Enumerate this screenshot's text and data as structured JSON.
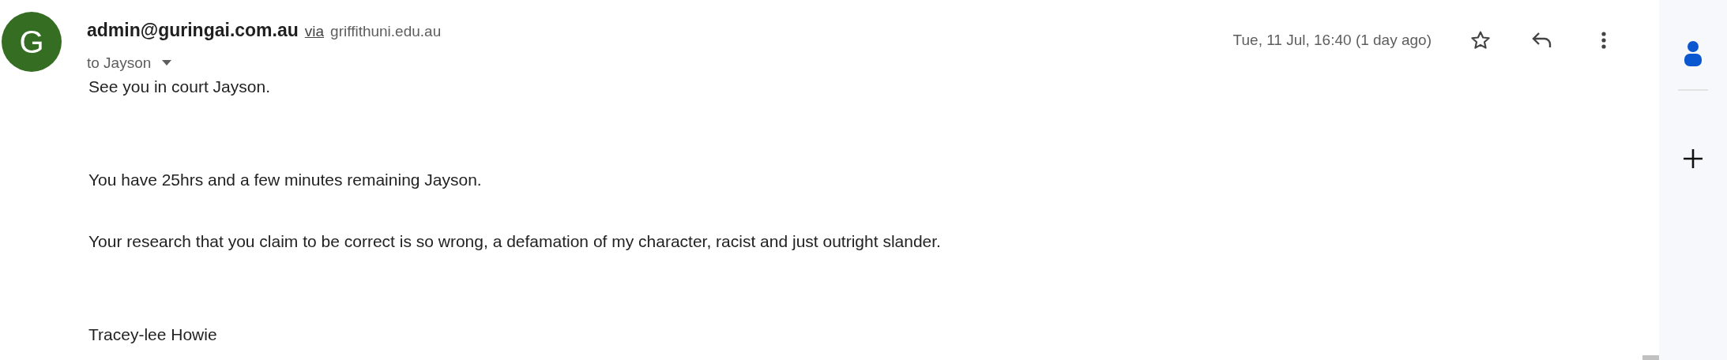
{
  "message": {
    "sender": {
      "avatar_letter": "G",
      "email": "admin@guringai.com.au",
      "via_label": "via",
      "via_domain": "griffithuni.edu.au"
    },
    "recipient": "to Jayson",
    "date": "Tue, 11 Jul, 16:40 (1 day ago)",
    "starred": false,
    "body": [
      "See you in court Jayson.",
      "You have 25hrs and a few minutes remaining Jayson.",
      "Your research that you claim to be correct is so wrong, a defamation of my character, racist and just outright slander.",
      "Tracey-lee Howie"
    ]
  }
}
